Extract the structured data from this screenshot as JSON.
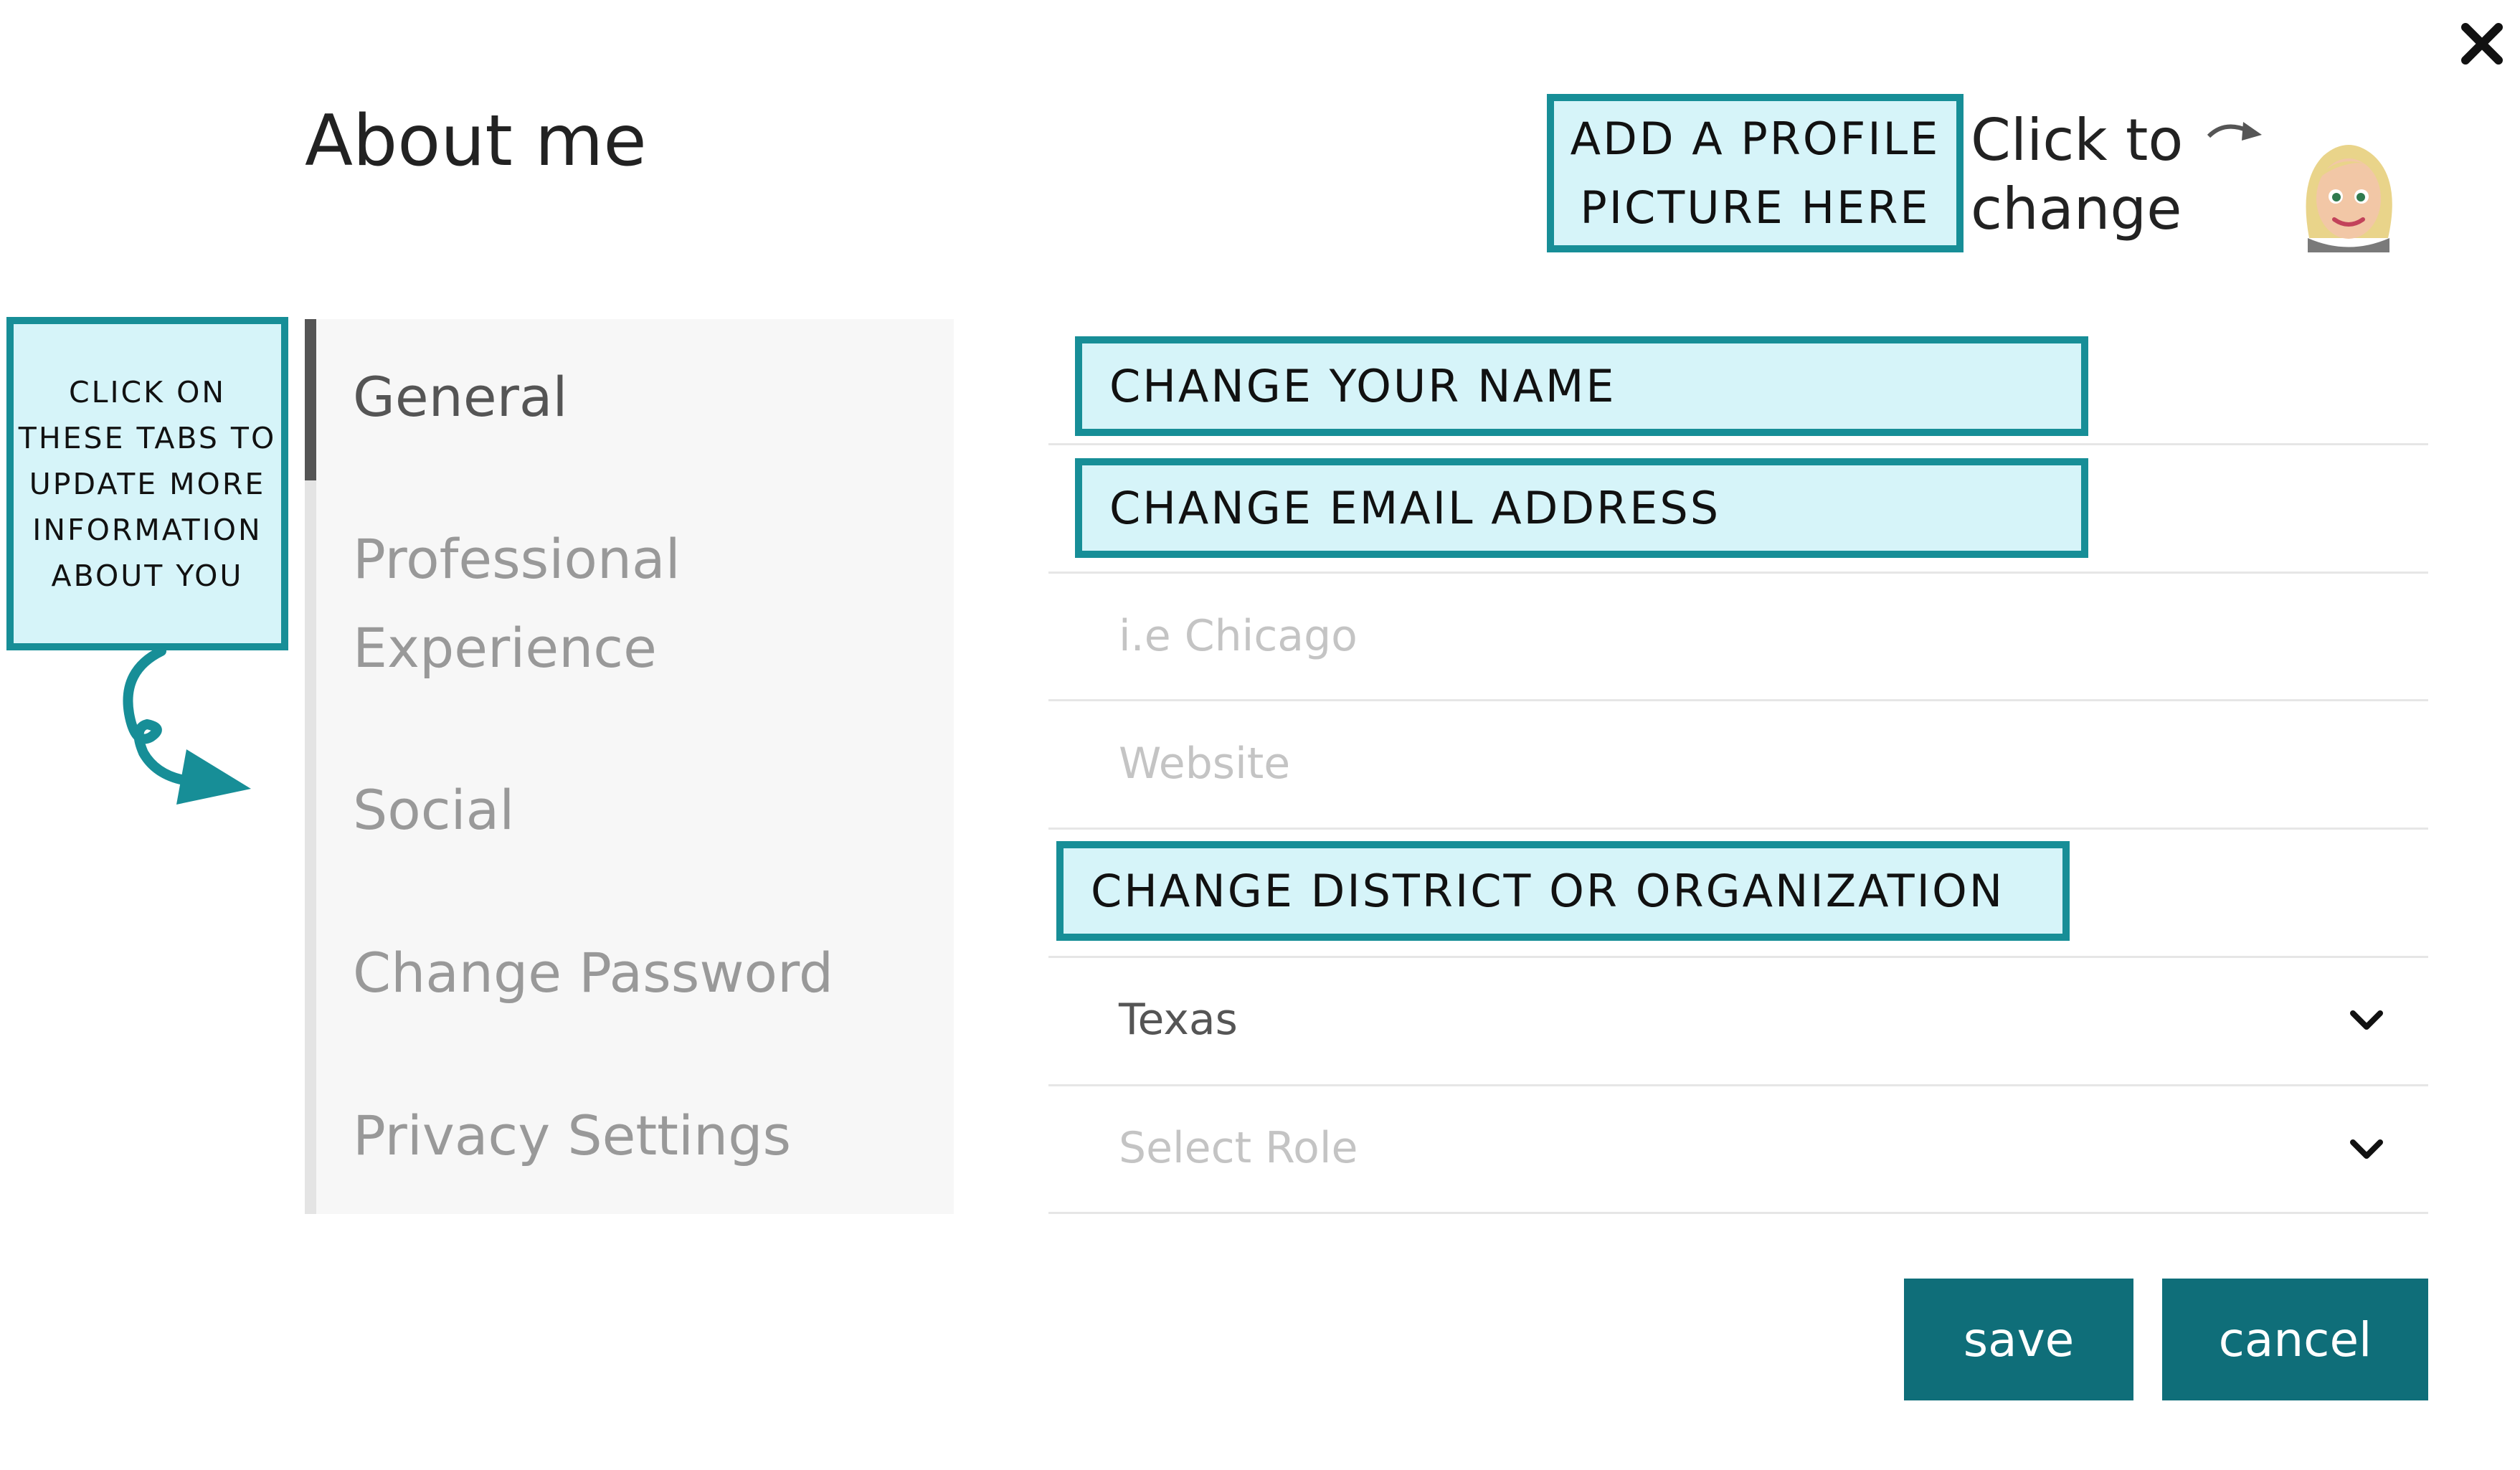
{
  "header": {
    "title": "About me",
    "click_to_change": "Click to change"
  },
  "callouts": {
    "profile": "ADD A PROFILE PICTURE HERE",
    "tabs": "CLICK ON THESE TABS TO UPDATE MORE INFORMATION ABOUT YOU",
    "name": "CHANGE YOUR NAME",
    "email": "CHANGE EMAIL ADDRESS",
    "district": "CHANGE DISTRICT OR ORGANIZATION"
  },
  "tabs": [
    {
      "label": "General",
      "active": true
    },
    {
      "label": "Professional Experience",
      "active": false
    },
    {
      "label": "Social",
      "active": false
    },
    {
      "label": "Change Password",
      "active": false
    },
    {
      "label": "Privacy Settings",
      "active": false
    }
  ],
  "form": {
    "location": {
      "placeholder": "i.e Chicago",
      "value": ""
    },
    "website": {
      "placeholder": "Website",
      "value": ""
    },
    "state": {
      "value": "Texas"
    },
    "role": {
      "placeholder": "Select Role"
    }
  },
  "buttons": {
    "save": "save",
    "cancel": "cancel"
  },
  "colors": {
    "accent": "#0f6e79",
    "callout_fill": "#d6f4f9",
    "callout_border": "#178e97"
  },
  "icons": [
    "close-icon",
    "avatar-icon",
    "chevron-down-icon"
  ]
}
